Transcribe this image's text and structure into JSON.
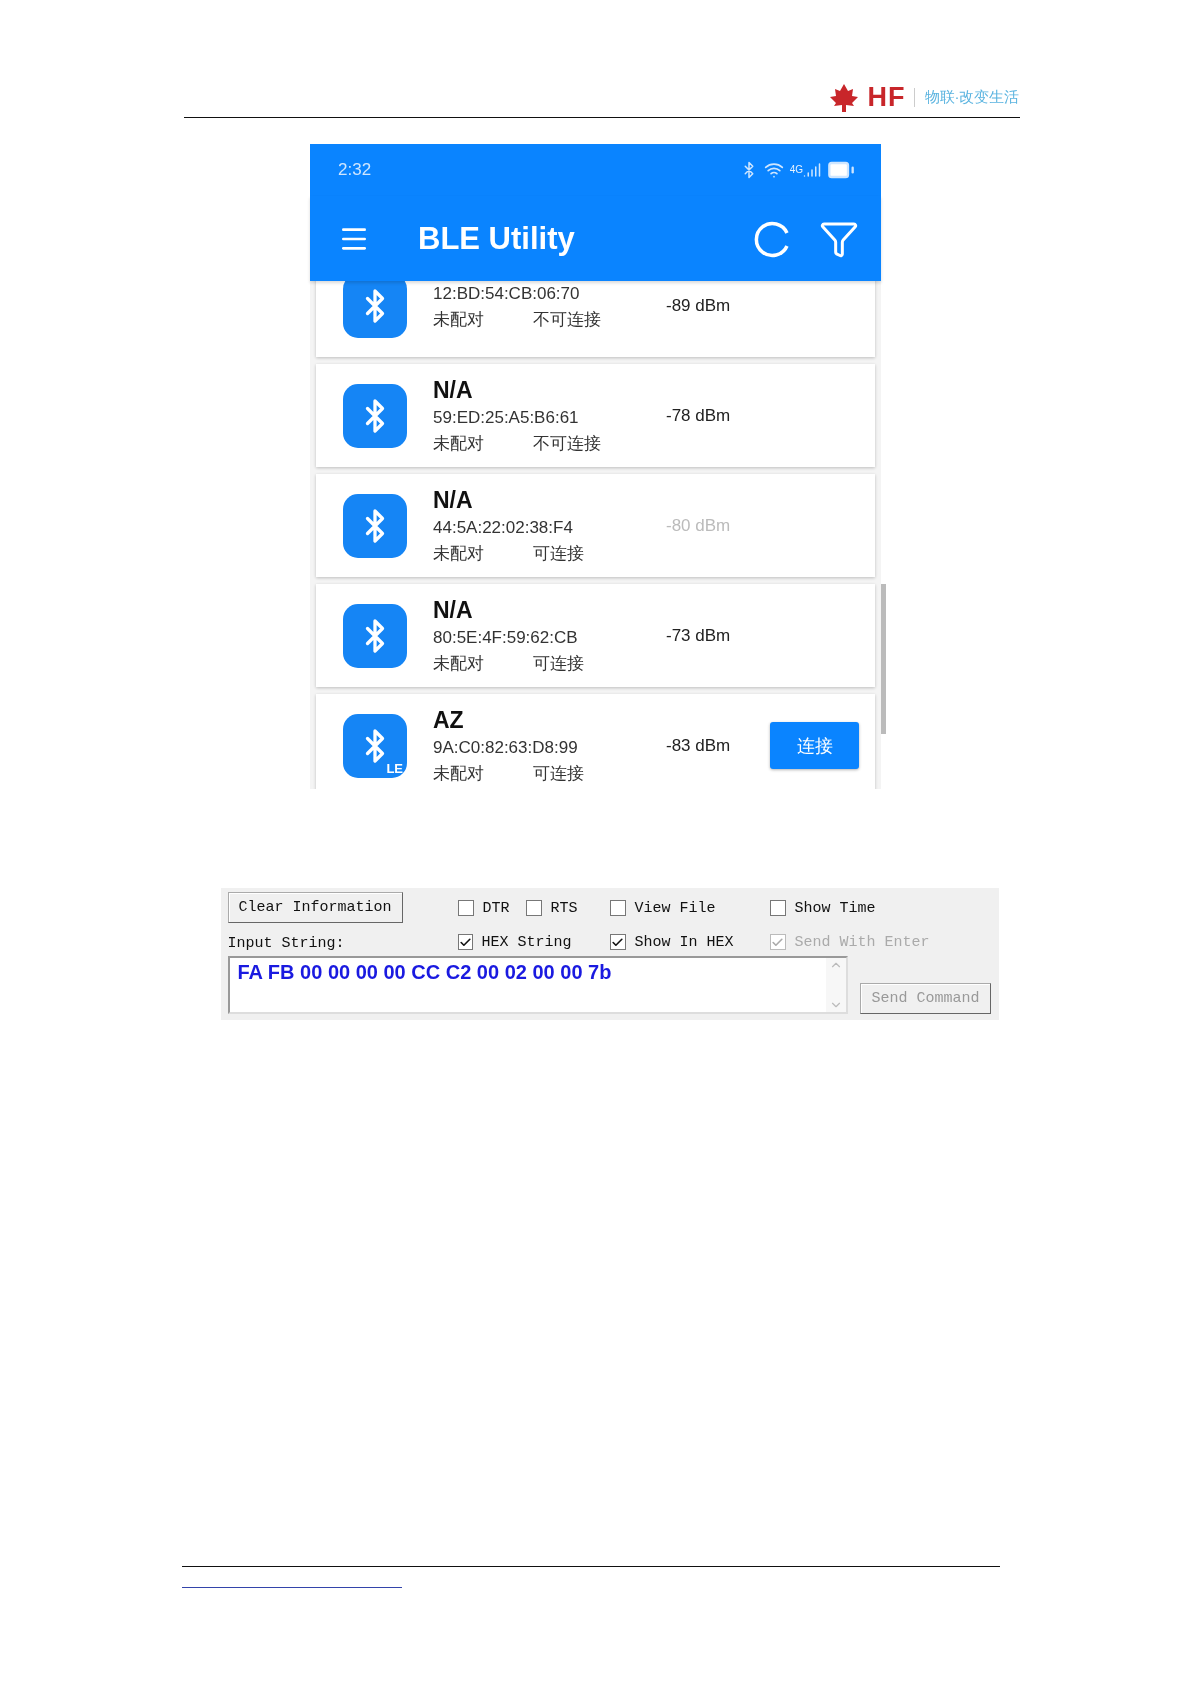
{
  "header": {
    "logo_text": "HF",
    "slogan": "物联·改变生活"
  },
  "phone": {
    "status_bar": {
      "time": "2:32",
      "network": "4G"
    },
    "app_bar": {
      "title": "BLE Utility"
    },
    "devices": [
      {
        "mac": "12:BD:54:CB:06:70",
        "rssi": "-89 dBm",
        "dimmed": false,
        "paired": "未配对",
        "connectable": "不可连接",
        "kind": "classic"
      },
      {
        "name": "N/A",
        "mac": "59:ED:25:A5:B6:61",
        "rssi": "-78 dBm",
        "dimmed": false,
        "paired": "未配对",
        "connectable": "不可连接",
        "kind": "classic"
      },
      {
        "name": "N/A",
        "mac": "44:5A:22:02:38:F4",
        "rssi": "-80 dBm",
        "dimmed": true,
        "paired": "未配对",
        "connectable": "可连接",
        "kind": "classic"
      },
      {
        "name": "N/A",
        "mac": "80:5E:4F:59:62:CB",
        "rssi": "-73 dBm",
        "dimmed": false,
        "paired": "未配对",
        "connectable": "可连接",
        "kind": "classic"
      },
      {
        "name": "AZ",
        "mac": "9A:C0:82:63:D8:99",
        "rssi": "-83 dBm",
        "dimmed": false,
        "paired": "未配对",
        "connectable": "可连接",
        "kind": "le",
        "badge": "LE",
        "button": "连接"
      }
    ]
  },
  "serial_panel": {
    "clear_button": "Clear Information",
    "input_label": "Input String:",
    "input_value": "FA FB 00 00 00 00 CC C2 00 02 00 00 7b",
    "send_button": "Send Command",
    "options": [
      {
        "label": "DTR",
        "checked": false,
        "disabled": false
      },
      {
        "label": "RTS",
        "checked": false,
        "disabled": false
      },
      {
        "label": "View File",
        "checked": false,
        "disabled": false
      },
      {
        "label": "Show Time",
        "checked": false,
        "disabled": false
      },
      {
        "label": "HEX String",
        "checked": true,
        "disabled": false
      },
      {
        "label": "Show In HEX",
        "checked": true,
        "disabled": false
      },
      {
        "label": "Send With Enter",
        "checked": true,
        "disabled": true
      }
    ]
  }
}
